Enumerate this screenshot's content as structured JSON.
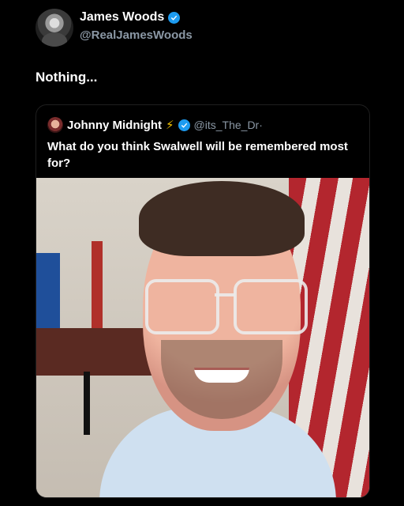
{
  "post": {
    "author_name": "James Woods",
    "author_handle": "@RealJamesWoods",
    "text": "Nothing..."
  },
  "quoted": {
    "author_name": "Johnny Midnight",
    "name_emoji": "⚡",
    "author_handle": "@its_The_Dr·",
    "text": "What do you think Swalwell will be remembered most for?"
  },
  "icons": {
    "verified": "verified-badge-icon",
    "bolt": "lightning-bolt-icon"
  },
  "colors": {
    "verified": "#1d9bf0",
    "background": "#000000",
    "handle": "#8b98a5"
  }
}
